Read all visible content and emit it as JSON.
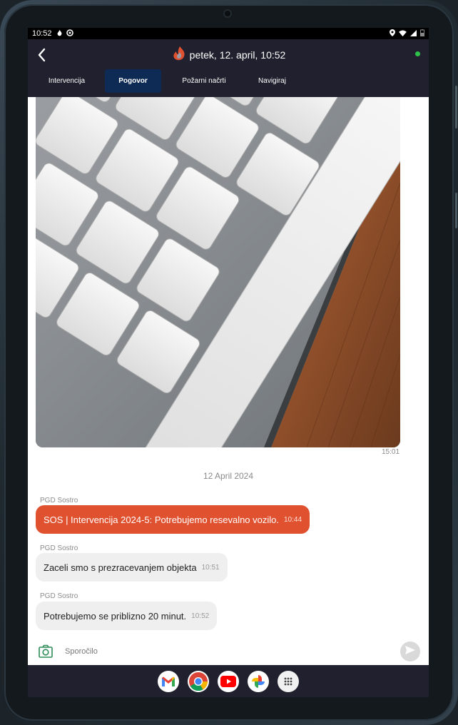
{
  "status_bar": {
    "time": "10:52",
    "icons_left": [
      "flame-icon",
      "settings-icon"
    ],
    "icons_right": [
      "location-icon",
      "wifi-icon",
      "signal-icon",
      "battery-icon"
    ]
  },
  "header": {
    "title": "petek, 12. april, 10:52",
    "online_color": "#2ec24a",
    "logo_icon": "flame-logo-icon"
  },
  "tabs": [
    {
      "label": "Intervencija",
      "active": false
    },
    {
      "label": "Pogovor",
      "active": true
    },
    {
      "label": "Požarni načrti",
      "active": false
    },
    {
      "label": "Navigiraj",
      "active": false
    }
  ],
  "chat": {
    "image_message": {
      "time": "15:01",
      "image_subject": "keyboard-photo"
    },
    "date_separator": "12 April 2024",
    "messages": [
      {
        "sender": "PGD Sostro",
        "text": "SOS | Intervencija 2024-5: Potrebujemo resevalno vozilo.",
        "time": "10:44",
        "type": "sos"
      },
      {
        "sender": "PGD Sostro",
        "text": "Zaceli smo s prezracevanjem objekta",
        "time": "10:51",
        "type": "normal"
      },
      {
        "sender": "PGD Sostro",
        "text": "Potrebujemo se priblizno 20 minut.",
        "time": "10:52",
        "type": "normal"
      }
    ]
  },
  "composer": {
    "placeholder": "Sporočilo",
    "camera_icon": "camera-icon",
    "send_icon": "send-icon"
  },
  "dock": {
    "apps": [
      "gmail-icon",
      "chrome-icon",
      "youtube-icon",
      "photos-icon",
      "app-drawer-icon"
    ]
  },
  "colors": {
    "appbar": "#20202e",
    "active_tab": "#0d2b55",
    "sos_bubble": "#e0512f",
    "normal_bubble": "#efefef",
    "accent_green": "#2e8b57"
  }
}
